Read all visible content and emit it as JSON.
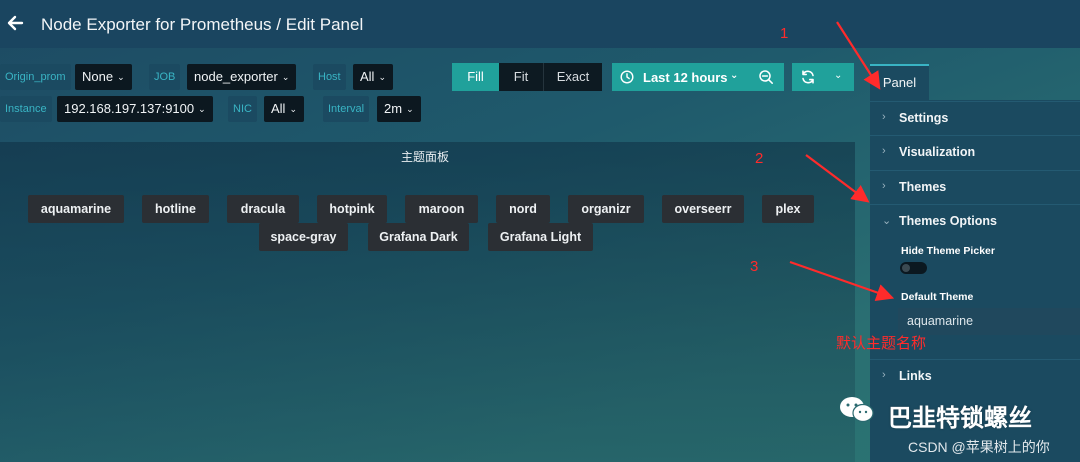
{
  "header": {
    "title": "Node Exporter for Prometheus / Edit Panel",
    "back_icon": "arrow-left-icon"
  },
  "variables": {
    "origin_prom_label": "Origin_prom",
    "origin_prom_value": "None",
    "job_label": "JOB",
    "job_value": "node_exporter",
    "host_label": "Host",
    "host_value": "All",
    "instance_label": "Instance",
    "instance_value": "192.168.197.137:9100",
    "nic_label": "NIC",
    "nic_value": "All",
    "interval_label": "Interval",
    "interval_value": "2m"
  },
  "toolbar": {
    "fill_label": "Fill",
    "fit_label": "Fit",
    "exact_label": "Exact",
    "time_range_label": "Last 12 hours",
    "clock_icon": "clock-icon",
    "zoom_out_icon": "zoom-out-icon",
    "refresh_icon": "refresh-icon"
  },
  "panel": {
    "title": "主题面板",
    "themes": [
      "aquamarine",
      "hotline",
      "dracula",
      "hotpink",
      "maroon",
      "nord",
      "organizr",
      "overseerr",
      "plex",
      "space-gray",
      "Grafana Dark",
      "Grafana Light"
    ]
  },
  "options": {
    "tab_label": "Panel",
    "sections": [
      "Settings",
      "Visualization",
      "Themes",
      "Themes Options",
      "Links"
    ],
    "hide_theme_picker_label": "Hide Theme Picker",
    "hide_theme_picker_enabled": false,
    "default_theme_label": "Default Theme",
    "default_theme_value": "aquamarine"
  },
  "annotations": {
    "step1": "1",
    "step2": "2",
    "step3": "3",
    "default_theme_note": "默认主题名称",
    "color": "#ff2b2b"
  },
  "watermark": {
    "main": "巴韭特锁螺丝",
    "csdn": "CSDN @苹果树上的你"
  },
  "colors": {
    "accent": "#20a19b",
    "label_text": "#39b4c4",
    "header_bg": "#1a4560"
  }
}
